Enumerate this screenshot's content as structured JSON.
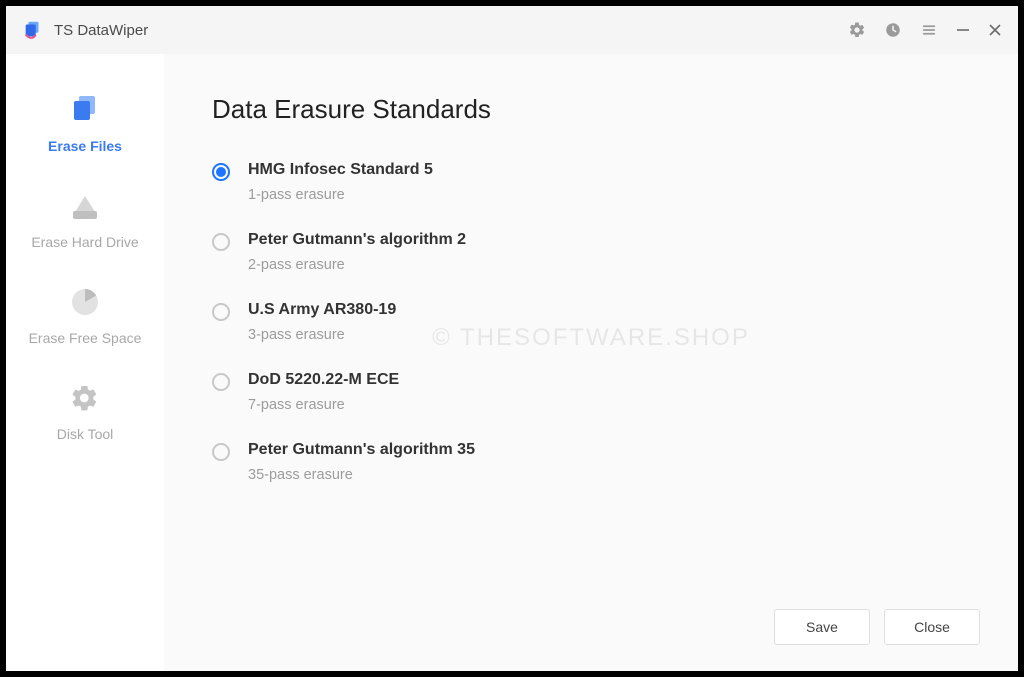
{
  "app": {
    "title": "TS DataWiper"
  },
  "sidebar": {
    "items": [
      {
        "label": "Erase Files"
      },
      {
        "label": "Erase Hard Drive"
      },
      {
        "label": "Erase Free Space"
      },
      {
        "label": "Disk Tool"
      }
    ]
  },
  "main": {
    "title": "Data Erasure Standards",
    "options": [
      {
        "name": "HMG Infosec Standard 5",
        "desc": "1-pass erasure",
        "selected": true
      },
      {
        "name": "Peter Gutmann's algorithm 2",
        "desc": "2-pass erasure",
        "selected": false
      },
      {
        "name": "U.S Army AR380-19",
        "desc": "3-pass erasure",
        "selected": false
      },
      {
        "name": "DoD 5220.22-M ECE",
        "desc": "7-pass erasure",
        "selected": false
      },
      {
        "name": "Peter Gutmann's algorithm 35",
        "desc": "35-pass erasure",
        "selected": false
      }
    ]
  },
  "footer": {
    "save_label": "Save",
    "close_label": "Close"
  },
  "watermark": "© THESOFTWARE.SHOP"
}
